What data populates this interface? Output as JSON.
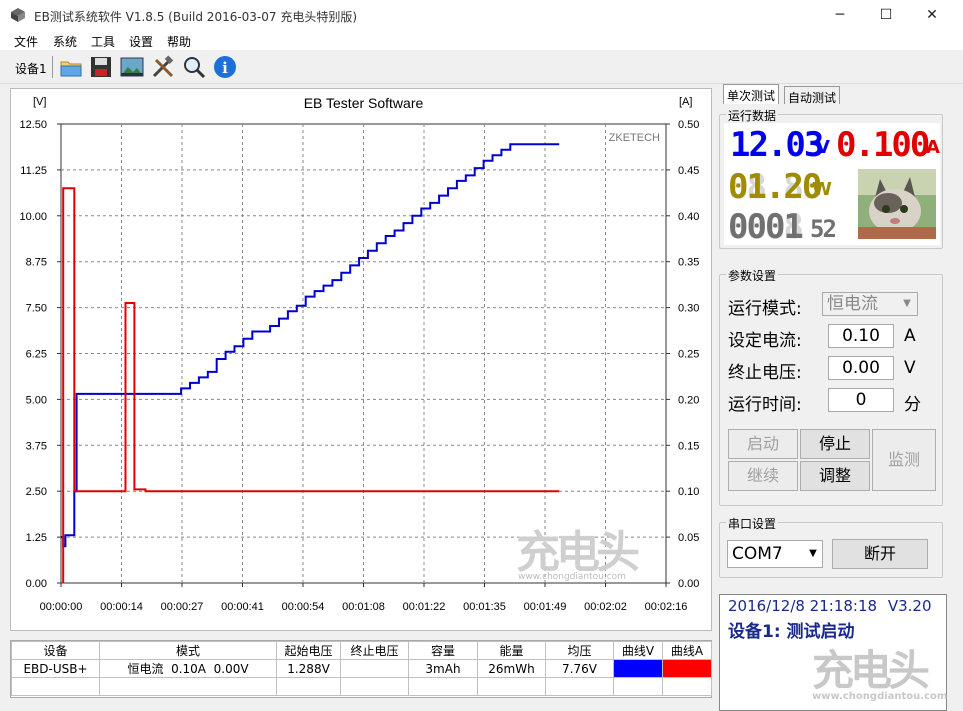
{
  "window": {
    "title": "EB测试系统软件 V1.8.5 (Build 2016-03-07 充电头特别版)",
    "minimize": "─",
    "maximize": "☐",
    "close": "✕"
  },
  "menu": [
    "文件",
    "系统",
    "工具",
    "设置",
    "帮助"
  ],
  "toolbar": {
    "device_label": "设备1",
    "icons": [
      "open-folder-icon",
      "save-icon",
      "image-icon",
      "tools-icon",
      "search-icon",
      "info-icon"
    ]
  },
  "chart_data": {
    "type": "line",
    "title": "EB Tester Software",
    "watermark": "ZKETECH",
    "left_axis_unit": "[V]",
    "right_axis_unit": "[A]",
    "ylim_left": [
      0,
      12.5
    ],
    "ylim_right": [
      0,
      0.5
    ],
    "y_ticks_left": [
      "12.50",
      "11.25",
      "10.00",
      "8.75",
      "7.50",
      "6.25",
      "5.00",
      "3.75",
      "2.50",
      "1.25",
      "0.00"
    ],
    "y_ticks_right": [
      "0.50",
      "0.45",
      "0.40",
      "0.35",
      "0.30",
      "0.25",
      "0.20",
      "0.15",
      "0.10",
      "0.05",
      "0.00"
    ],
    "x_ticks": [
      "00:00:00",
      "00:00:14",
      "00:00:27",
      "00:00:41",
      "00:00:54",
      "00:01:08",
      "00:01:22",
      "00:01:35",
      "00:01:49",
      "00:02:02",
      "00:02:16"
    ],
    "xlim": [
      0,
      136
    ],
    "grid": true,
    "series": [
      {
        "name": "曲线V",
        "color": "#0000cc",
        "axis": "left",
        "points": [
          [
            0,
            1.25
          ],
          [
            0.5,
            1.25
          ],
          [
            0.5,
            1.0
          ],
          [
            1,
            1.0
          ],
          [
            1,
            1.3
          ],
          [
            3,
            1.3
          ],
          [
            3,
            2.5
          ],
          [
            3.5,
            2.5
          ],
          [
            3.5,
            5.15
          ],
          [
            27,
            5.15
          ],
          [
            27,
            5.3
          ],
          [
            29,
            5.3
          ],
          [
            29,
            5.45
          ],
          [
            31,
            5.45
          ],
          [
            31,
            5.6
          ],
          [
            33,
            5.6
          ],
          [
            33,
            5.75
          ],
          [
            35,
            5.75
          ],
          [
            35,
            6.1
          ],
          [
            37,
            6.1
          ],
          [
            37,
            6.3
          ],
          [
            39,
            6.3
          ],
          [
            39,
            6.45
          ],
          [
            41,
            6.45
          ],
          [
            41,
            6.65
          ],
          [
            43,
            6.65
          ],
          [
            43,
            6.85
          ],
          [
            47,
            6.85
          ],
          [
            47,
            7.0
          ],
          [
            49,
            7.0
          ],
          [
            49,
            7.2
          ],
          [
            51,
            7.2
          ],
          [
            51,
            7.4
          ],
          [
            53,
            7.4
          ],
          [
            53,
            7.55
          ],
          [
            55,
            7.55
          ],
          [
            55,
            7.8
          ],
          [
            57,
            7.8
          ],
          [
            57,
            7.95
          ],
          [
            59,
            7.95
          ],
          [
            59,
            8.1
          ],
          [
            61,
            8.1
          ],
          [
            61,
            8.25
          ],
          [
            63,
            8.25
          ],
          [
            63,
            8.45
          ],
          [
            65,
            8.45
          ],
          [
            65,
            8.65
          ],
          [
            67,
            8.65
          ],
          [
            67,
            8.85
          ],
          [
            69,
            8.85
          ],
          [
            69,
            9.05
          ],
          [
            71,
            9.05
          ],
          [
            71,
            9.25
          ],
          [
            73,
            9.25
          ],
          [
            73,
            9.45
          ],
          [
            75,
            9.45
          ],
          [
            75,
            9.6
          ],
          [
            77,
            9.6
          ],
          [
            77,
            9.8
          ],
          [
            79,
            9.8
          ],
          [
            79,
            10.0
          ],
          [
            81,
            10.0
          ],
          [
            81,
            10.2
          ],
          [
            83,
            10.2
          ],
          [
            83,
            10.35
          ],
          [
            85,
            10.35
          ],
          [
            85,
            10.55
          ],
          [
            87,
            10.55
          ],
          [
            87,
            10.75
          ],
          [
            89,
            10.75
          ],
          [
            89,
            10.95
          ],
          [
            91,
            10.95
          ],
          [
            91,
            11.1
          ],
          [
            93,
            11.1
          ],
          [
            93,
            11.3
          ],
          [
            95,
            11.3
          ],
          [
            95,
            11.5
          ],
          [
            97,
            11.5
          ],
          [
            97,
            11.65
          ],
          [
            99,
            11.65
          ],
          [
            99,
            11.8
          ],
          [
            101,
            11.8
          ],
          [
            101,
            11.95
          ],
          [
            112,
            11.95
          ]
        ]
      },
      {
        "name": "曲线A",
        "color": "#e00000",
        "axis": "right",
        "points": [
          [
            0.5,
            0
          ],
          [
            0.5,
            0.43
          ],
          [
            3,
            0.43
          ],
          [
            3,
            0.1
          ],
          [
            14.5,
            0.1
          ],
          [
            14.5,
            0.305
          ],
          [
            16.5,
            0.305
          ],
          [
            16.5,
            0.102
          ],
          [
            19,
            0.102
          ],
          [
            19,
            0.1
          ],
          [
            112,
            0.1
          ]
        ]
      }
    ]
  },
  "right_panel": {
    "tabs": [
      "单次测试",
      "自动测试"
    ],
    "run_data": {
      "title": "运行数据",
      "voltage": "12.03",
      "voltage_unit": "V",
      "current": "0.100",
      "current_unit": "A",
      "power": "01.20",
      "power_unit": "W",
      "time_display": "0001",
      "time_suffix": "52",
      "ghost_power": "88.88",
      "ghost_time": "8888"
    },
    "params": {
      "title": "参数设置",
      "mode_label": "运行模式:",
      "mode_value": "恒电流",
      "current_label": "设定电流:",
      "current_value": "0.10",
      "current_unit": "A",
      "cutoff_label": "终止电压:",
      "cutoff_value": "0.00",
      "cutoff_unit": "V",
      "time_label": "运行时间:",
      "time_value": "0",
      "time_unit": "分",
      "buttons": {
        "start": "启动",
        "stop": "停止",
        "continue": "继续",
        "adjust": "调整",
        "monitor": "监测"
      }
    },
    "serial": {
      "title": "串口设置",
      "port": "COM7",
      "disconnect": "断开"
    },
    "status": {
      "datetime": "2016/12/8 21:18:18",
      "version": "V3.20",
      "message": "设备1: 测试启动"
    }
  },
  "table": {
    "headers": [
      "设备",
      "模式",
      "起始电压",
      "终止电压",
      "容量",
      "能量",
      "均压",
      "曲线V",
      "曲线A"
    ],
    "rows": [
      [
        "EBD-USB+",
        "恒电流  0.10A  0.00V",
        "1.288V",
        "",
        "3mAh",
        "26mWh",
        "7.76V",
        "",
        ""
      ]
    ],
    "curve_v_color": "#0000ff",
    "curve_a_color": "#ff0000"
  },
  "watermarks": {
    "brand": "充电头",
    "url": "www.chongdiantou.com"
  }
}
